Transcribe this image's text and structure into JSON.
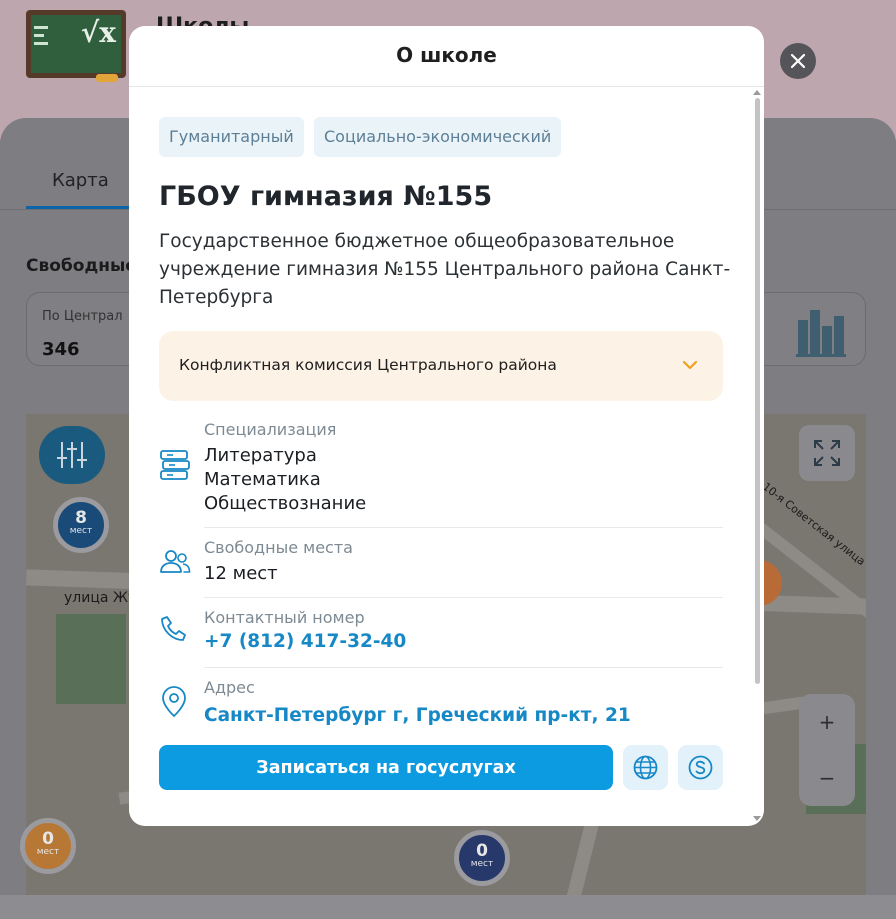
{
  "background": {
    "header_title": "Школы",
    "tab_map": "Карта",
    "free_places_heading": "Свободные",
    "stats_label": "По Централ",
    "stats_value": "346",
    "map_street_1": "улица Жуко",
    "map_street_2": "10-я Советская улица",
    "map_pins": [
      {
        "count": "8",
        "unit": "мест"
      },
      {
        "count": "0",
        "unit": "мест"
      },
      {
        "count": "0",
        "unit": "мест"
      }
    ],
    "zoom_in": "+",
    "zoom_out": "−"
  },
  "modal": {
    "title": "О школе",
    "tags": [
      "Гуманитарный",
      "Социально-экономический"
    ],
    "school_name": "ГБОУ гимназия №155",
    "school_full_name": "Государственное бюджетное общеобразовательное учреждение гимназия №155 Центрального района Санкт-Петербурга",
    "commission": {
      "label": "Конфликтная комиссия Центрального района",
      "icon": "chevron-down-icon"
    },
    "specialization": {
      "label": "Специализация",
      "items": [
        "Литература",
        "Математика",
        "Обществознание"
      ],
      "icon": "books-icon"
    },
    "free_places": {
      "label": "Свободные места",
      "value": "12 мест",
      "icon": "people-icon"
    },
    "contact": {
      "label": "Контактный номер",
      "value": "+7 (812) 417-32-40",
      "icon": "phone-icon"
    },
    "address": {
      "label": "Адрес",
      "value": "Санкт-Петербург г, Греческий пр-кт, 21",
      "icon": "location-pin-icon"
    },
    "enroll_button": "Записаться на госуслугах",
    "website_icon": "globe-icon",
    "gosuslugi_icon": "gosuslugi-icon",
    "close_icon": "close-icon"
  },
  "colors": {
    "accent": "#0c9ae0",
    "link": "#1688c6",
    "tag_bg": "#eaf3f8",
    "commission_bg": "#fdf2e6",
    "chevron": "#f0a020"
  }
}
